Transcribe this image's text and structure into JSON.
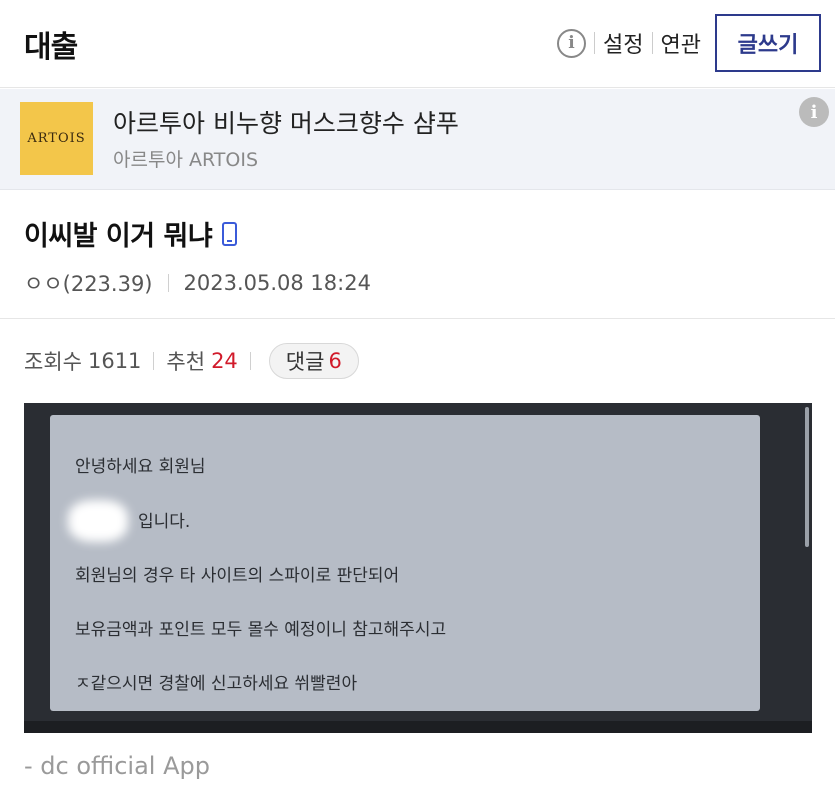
{
  "header": {
    "board_title": "대출",
    "info_icon": "info-circle-icon",
    "settings_label": "설정",
    "related_label": "연관",
    "write_label": "글쓰기",
    "accent_color": "#2d3a8c"
  },
  "ad": {
    "logo_text": "ARTOIS",
    "title": "아르투아 비누향 머스크향수 샴푸",
    "brand": "아르투아 ARTOIS",
    "info_icon": "info-icon"
  },
  "post": {
    "title": "이씨발 이거 뭐냐",
    "device_icon": "mobile-phone-icon",
    "author": "ㅇㅇ(223.39)",
    "datetime": "2023.05.08 18:24",
    "views_label": "조회수",
    "views": "1611",
    "recommend_label": "추천",
    "recommend": "24",
    "replies_label": "댓글",
    "replies": "6"
  },
  "image_message": {
    "lines": [
      "안녕하세요 회원님",
      "입니다.",
      "회원님의 경우 타 사이트의 스파이로 판단되어",
      "보유금액과 포인트 모두 몰수 예정이니 참고해주시고",
      "ㅈ같으시면 경찰에 신고하세요 쒸빨련아"
    ]
  },
  "footer": {
    "signature": "- dc official App"
  }
}
